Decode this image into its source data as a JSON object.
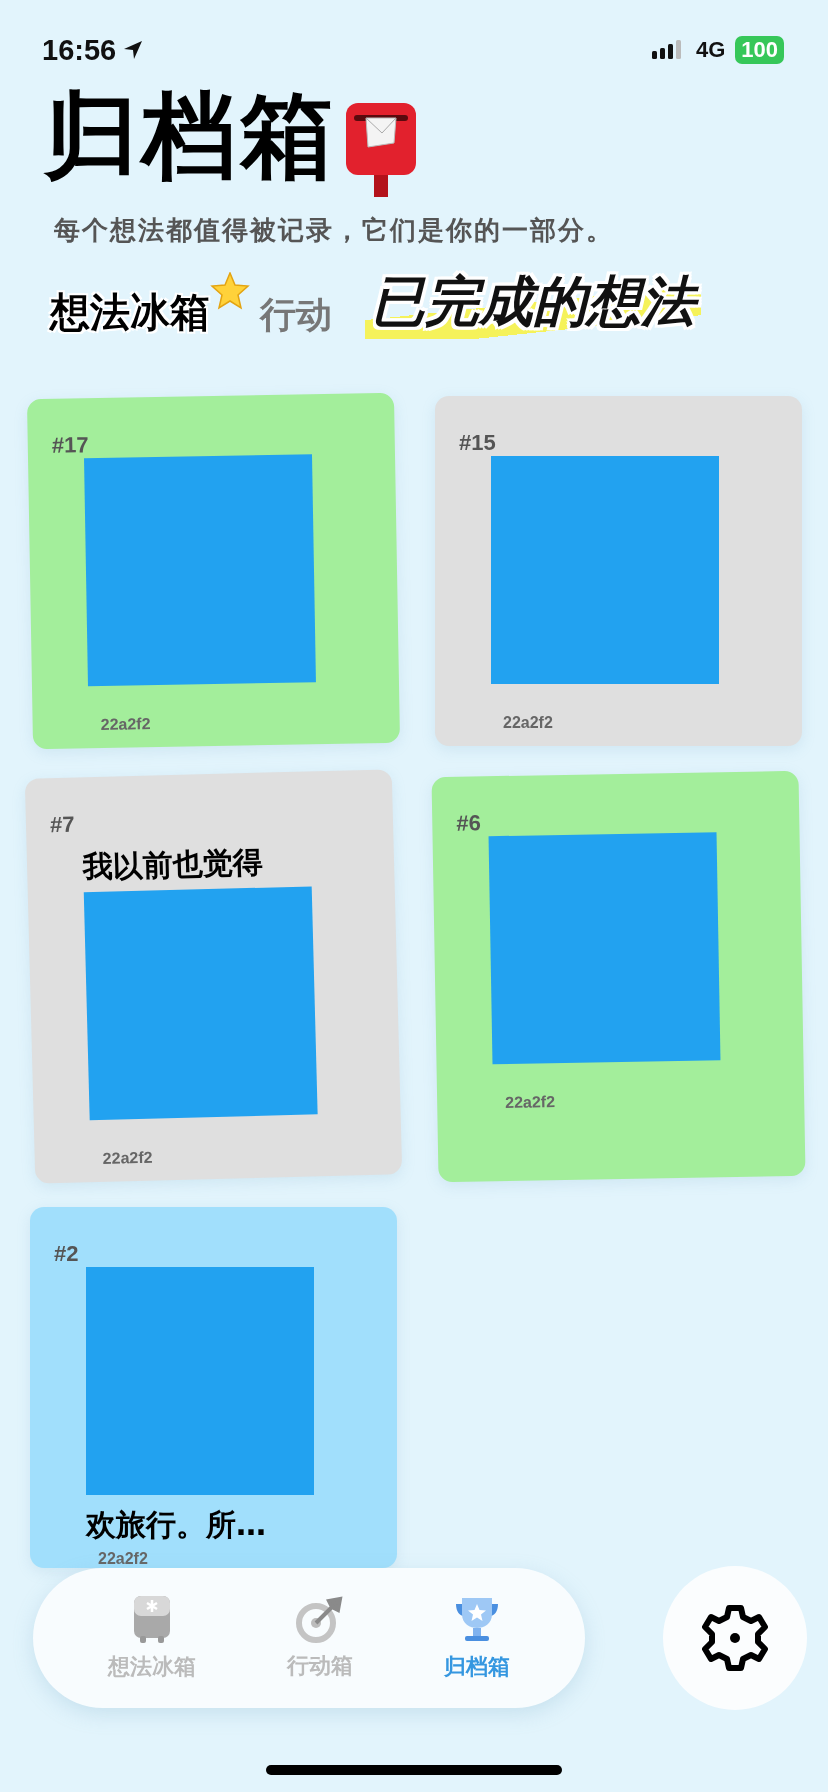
{
  "status_bar": {
    "time": "16:56",
    "network": "4G",
    "battery": "100"
  },
  "header": {
    "title": "归档箱",
    "subtitle": "每个想法都值得被记录，它们是你的一部分。"
  },
  "tabs": [
    {
      "label": "想法冰箱",
      "selected": true
    },
    {
      "label": "行动",
      "selected": false
    }
  ],
  "overlay_caption": "已完成的想法",
  "cards": [
    {
      "number": "#17",
      "color": "#a3ee9b",
      "content": [
        {
          "kind": "cover"
        }
      ],
      "stamp": "22a2f2"
    },
    {
      "number": "#15",
      "color": "#dfdfdf",
      "content": [
        {
          "kind": "cover"
        }
      ],
      "stamp": "22a2f2"
    },
    {
      "number": "#7",
      "color": "#dfdfdf",
      "content": [
        {
          "kind": "text",
          "text": "我以前也觉得"
        },
        {
          "kind": "cover"
        }
      ],
      "stamp": "22a2f2"
    },
    {
      "number": "#6",
      "color": "#a3ee9b",
      "content": [
        {
          "kind": "cover"
        }
      ],
      "stamp": "22a2f2"
    },
    {
      "number": "#2",
      "color": "#a1dffc",
      "content": [
        {
          "kind": "cover"
        },
        {
          "kind": "text",
          "text": "欢旅行。所…"
        }
      ],
      "stamp": "22a2f2"
    }
  ],
  "nav": [
    {
      "label": "想法冰箱",
      "kind": "fridge",
      "selected": false
    },
    {
      "label": "行动箱",
      "kind": "target",
      "selected": false
    },
    {
      "label": "归档箱",
      "kind": "trophy",
      "selected": true
    }
  ]
}
